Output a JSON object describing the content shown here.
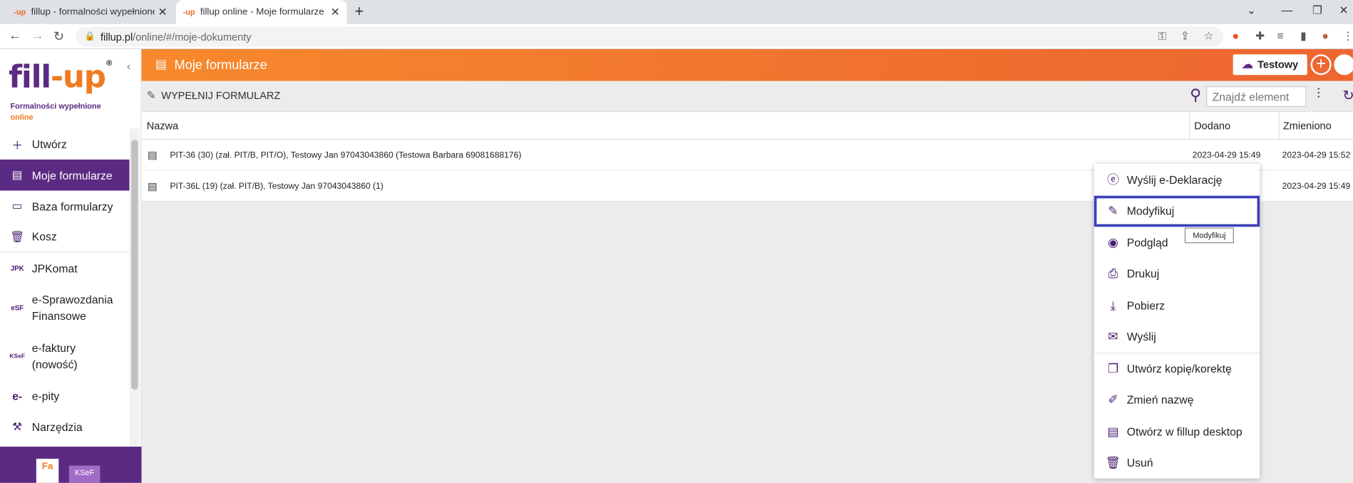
{
  "browser": {
    "tabs": [
      {
        "favicon": "-up",
        "title": "fillup - formalności wypełnione. F",
        "close": "✕"
      },
      {
        "favicon": "-up",
        "title": "fillup online - Moje formularze",
        "close": "✕"
      }
    ],
    "new_tab": "+",
    "url_host": "fillup.pl",
    "url_path": "/online/#/moje-dokumenty"
  },
  "sidebar": {
    "logo_fill": "fill",
    "logo_dash": "-",
    "logo_up": "up",
    "logo_mark": "®",
    "tagline_1": "Formalności wypełnione",
    "tagline_2": "online",
    "items": [
      {
        "label": "Utwórz",
        "icon": "plus-icon"
      },
      {
        "label": "Moje formularze",
        "icon": "document-icon"
      },
      {
        "label": "Baza formularzy",
        "icon": "folder-icon"
      },
      {
        "label": "Kosz",
        "icon": "trash-icon"
      },
      {
        "label": "JPKomat",
        "icon": "jpk-icon"
      },
      {
        "label": "e-Sprawozdania Finansowe",
        "icon": "esf-icon"
      },
      {
        "label": "e-faktury (nowość)",
        "icon": "ksef-icon"
      },
      {
        "label": "e-pity",
        "icon": "epity-icon"
      },
      {
        "label": "Narzędzia",
        "icon": "tools-icon"
      }
    ],
    "promo_fa": "Fa",
    "promo_ks": "KSeF"
  },
  "header": {
    "title": "Moje formularze",
    "account_label": "Testowy"
  },
  "toolbar": {
    "fill_label": "WYPEŁNIJ FORMULARZ",
    "search_placeholder": "Znajdź element"
  },
  "table": {
    "columns": {
      "name": "Nazwa",
      "added": "Dodano",
      "changed": "Zmieniono"
    },
    "rows": [
      {
        "name": "PIT-36 (30) (zał. PIT/B, PIT/O), Testowy Jan 97043043860 (Testowa Barbara 69081688176)",
        "added": "2023-04-29 15:49",
        "changed": "2023-04-29 15:52"
      },
      {
        "name": "PIT-36L (19) (zał. PIT/B), Testowy Jan 97043043860 (1)",
        "added": "",
        "changed": "2023-04-29 15:49"
      }
    ]
  },
  "context_menu": {
    "items": [
      {
        "label": "Wyślij e-Deklarację",
        "icon": "e-declaration-icon"
      },
      {
        "label": "Modyfikuj",
        "icon": "pencil-icon"
      },
      {
        "label": "Podgląd",
        "icon": "eye-icon"
      },
      {
        "label": "Drukuj",
        "icon": "printer-icon"
      },
      {
        "label": "Pobierz",
        "icon": "download-icon"
      },
      {
        "label": "Wyślij",
        "icon": "envelope-icon"
      },
      {
        "label": "Utwórz kopię/korektę",
        "icon": "copy-icon"
      },
      {
        "label": "Zmień nazwę",
        "icon": "rename-icon"
      },
      {
        "label": "Otwórz w fillup desktop",
        "icon": "desktop-icon"
      },
      {
        "label": "Usuń",
        "icon": "trash-icon"
      }
    ],
    "tooltip": "Modyfikuj"
  }
}
